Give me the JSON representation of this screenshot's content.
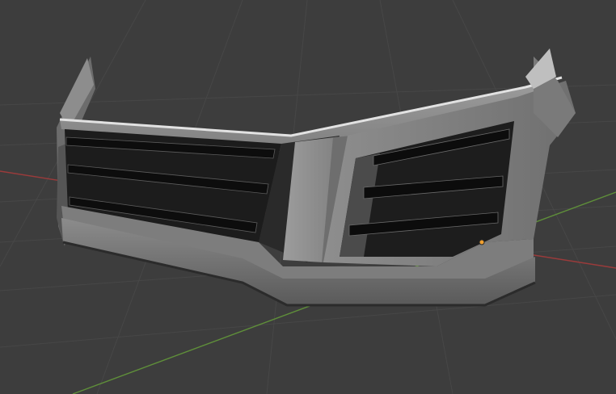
{
  "viewport": {
    "background": "#3d3d3d",
    "grid_color": "#454545",
    "x_axis_color": "#9a3b3b",
    "y_axis_color": "#5f8f3a",
    "origin_marker_color": "#f0a030"
  },
  "model": {
    "body_light": "#a7a7a7",
    "body_mid": "#8a8a8a",
    "body_dark": "#5e5e5e",
    "edge_highlight": "#dedede",
    "grille_dark": "#1b1b1b",
    "slat_color": "#0c0c0c"
  }
}
